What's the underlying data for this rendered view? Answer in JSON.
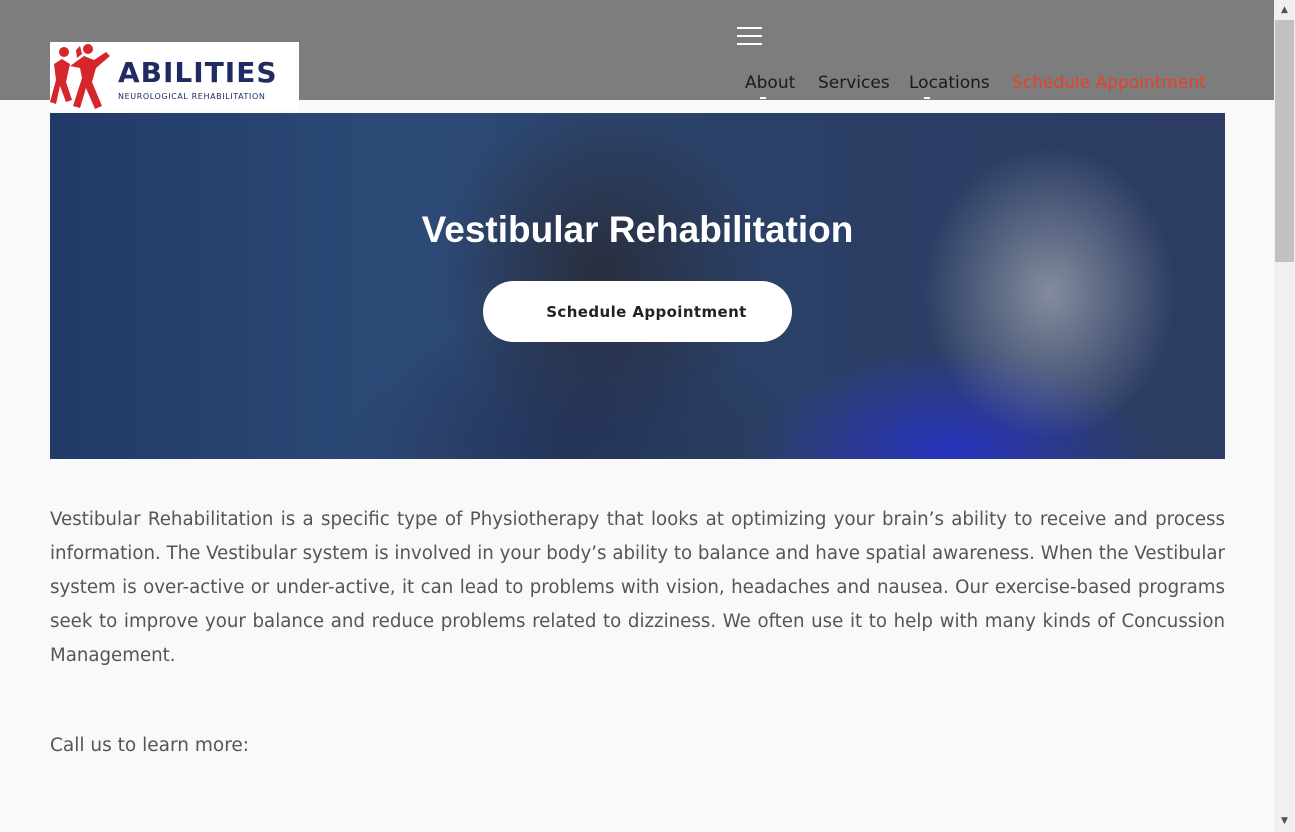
{
  "header": {
    "logo": {
      "title": "ABILITIES",
      "subtitle": "NEUROLOGICAL REHABILITATION"
    },
    "nav": [
      {
        "label": "About"
      },
      {
        "label": "Services"
      },
      {
        "label": "Locations"
      },
      {
        "label": "Schedule Appointment"
      }
    ]
  },
  "hero": {
    "title": "Vestibular Rehabilitation",
    "button_label": "Schedule Appointment"
  },
  "content": {
    "paragraph": "Vestibular Rehabilitation is a specific type of Physiotherapy that looks at optimizing your brain’s ability to receive and process information. The Vestibular system is involved in your body’s ability to balance and have spatial awareness. When the Vestibular system is over-active or under-active, it can lead to problems with vision, headaches and nausea. Our exercise-based programs seek to improve your balance and reduce problems related to dizziness. We often use it to help with many kinds of Concussion Management.",
    "call_to_action": "Call us to learn more:"
  },
  "colors": {
    "header_bg": "#7d7d7d",
    "brand_navy": "#1f2b62",
    "brand_red": "#d6262b",
    "nav_accent": "#e8402a",
    "body_text": "#555555"
  },
  "icons": {
    "menu": "hamburger-icon",
    "scroll_up": "triangle-up-icon",
    "scroll_down": "triangle-down-icon"
  }
}
